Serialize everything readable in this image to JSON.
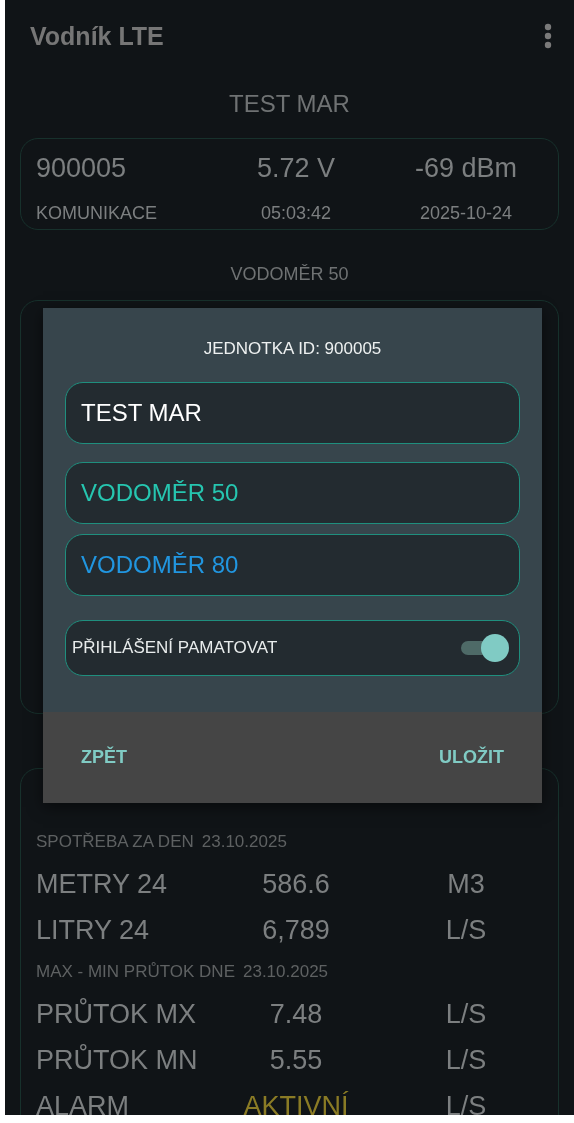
{
  "app_bar": {
    "title": "Vodník LTE"
  },
  "unit_title": "TEST MAR",
  "status_card": {
    "rows": [
      [
        "900005",
        "5.72 V",
        "-69 dBm"
      ],
      [
        "KOMUNIKACE",
        "05:03:42",
        "2025-10-24"
      ]
    ]
  },
  "meter_title": "VODOMĚR 50",
  "meter_card_2": {
    "rows": [
      {
        "kind": "header",
        "label": "SPOTŘEBA ZA DEN",
        "date": "23.10.2025"
      },
      {
        "kind": "big",
        "label": "METRY 24",
        "value": "586.6",
        "unit": "M3",
        "alert": false
      },
      {
        "kind": "big",
        "label": "LITRY 24",
        "value": "6,789",
        "unit": "L/S",
        "alert": false
      },
      {
        "kind": "header",
        "label": "MAX - MIN PRŮTOK DNE",
        "date": "23.10.2025"
      },
      {
        "kind": "big",
        "label": "PRŮTOK MX",
        "value": "7.48",
        "unit": "L/S",
        "alert": false
      },
      {
        "kind": "big",
        "label": "PRŮTOK MN",
        "value": "5.55",
        "unit": "L/S",
        "alert": false
      },
      {
        "kind": "big",
        "label": "ALARM",
        "value": "AKTIVNÍ",
        "unit": "L/S",
        "alert": true
      }
    ]
  },
  "dialog": {
    "title": "JEDNOTKA ID: 900005",
    "fields": [
      {
        "value": "TEST MAR",
        "color": "#ffffff"
      },
      {
        "value": "VODOMĚR 50",
        "color": "#26c6b0"
      },
      {
        "value": "VODOMĚR 80",
        "color": "#2196e0"
      }
    ],
    "toggle": {
      "label": "PŘIHLÁŠENÍ PAMATOVAT",
      "on": true
    },
    "buttons": [
      "ZPĚT",
      "ULOŽIT"
    ]
  }
}
